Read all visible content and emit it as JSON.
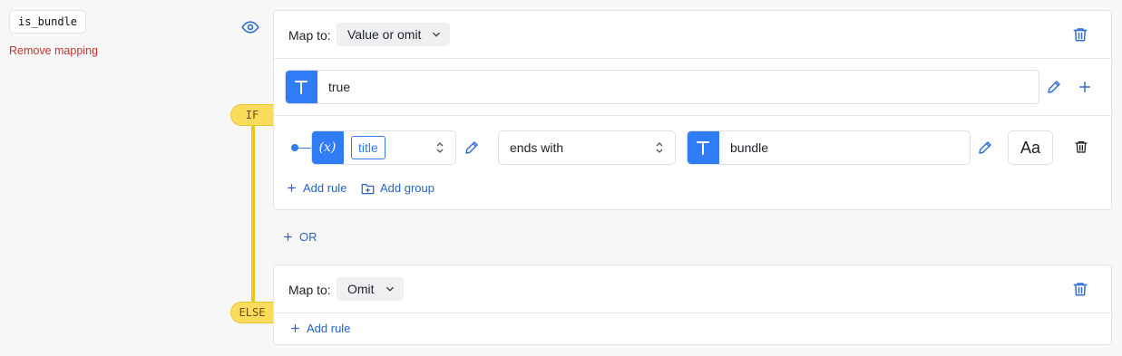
{
  "field": {
    "name": "is_bundle",
    "remove_label": "Remove mapping"
  },
  "if_badge": "IF",
  "else_badge": "ELSE",
  "if_block": {
    "map_to_label": "Map to:",
    "map_to_value": "Value or omit",
    "value_input": "true",
    "condition": {
      "variable": "title",
      "operator": "ends with",
      "operand": "bundle",
      "case_button": "Aa"
    },
    "add_rule_label": "Add rule",
    "add_group_label": "Add group"
  },
  "or_label": "OR",
  "else_block": {
    "map_to_label": "Map to:",
    "map_to_value": "Omit",
    "add_rule_label": "Add rule"
  },
  "colors": {
    "accent": "#2f7cf6",
    "link": "#2663d0",
    "danger": "#d0312d",
    "badge": "#f9dc5c",
    "connector": "#f2c51b"
  },
  "icons": [
    "eye-icon",
    "trash-icon",
    "text-type-icon",
    "pencil-icon",
    "plus-icon",
    "variable-icon",
    "folder-plus-icon",
    "chevron-down-icon",
    "updown-icon"
  ]
}
